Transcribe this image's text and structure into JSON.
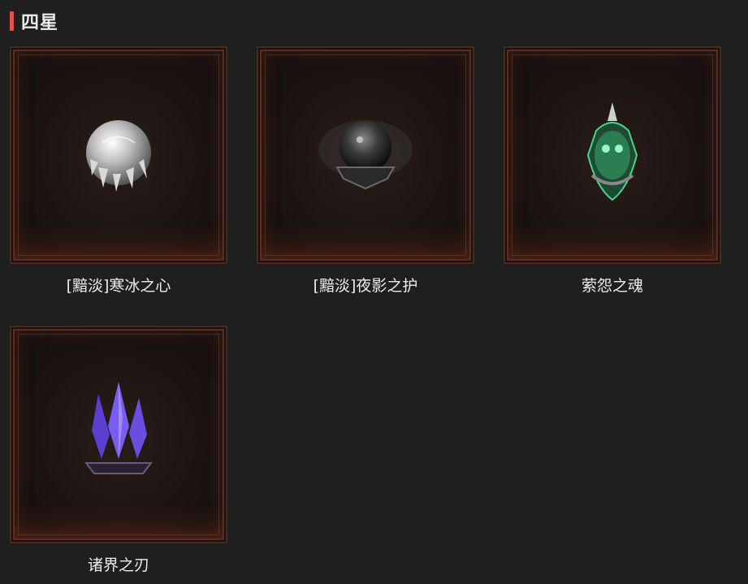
{
  "section": {
    "title": "四星"
  },
  "items": [
    {
      "name": "[黯淡]寒冰之心",
      "icon": "ice-orb-icon"
    },
    {
      "name": "[黯淡]夜影之护",
      "icon": "shadow-orb-icon"
    },
    {
      "name": "萦怨之魂",
      "icon": "green-spirit-icon"
    },
    {
      "name": "诸界之刃",
      "icon": "purple-crystal-icon"
    }
  ]
}
